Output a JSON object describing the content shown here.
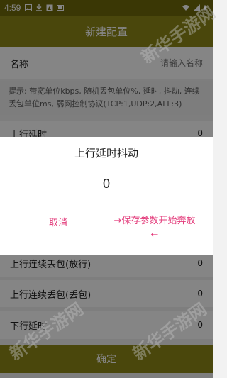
{
  "status_bar": {
    "time": "4:59",
    "left_icons": [
      "photo-icon",
      "download-icon",
      "image-icon",
      "app-badge-icon"
    ],
    "right_icons": [
      "wifi-icon",
      "signal-icon",
      "battery-icon"
    ]
  },
  "app_bar": {
    "title": "新建配置"
  },
  "form": {
    "name_label": "名称",
    "name_placeholder": "请输入名称",
    "hint": "提示: 带宽单位kbps, 随机丢包单位%, 延时, 抖动, 连续丢包单位ms, 弱网控制协议(TCP:1,UDP:2,ALL:3)",
    "rows": [
      {
        "label": "上行延时",
        "value": "0"
      },
      {
        "label": "上行连续丢包(放行)",
        "value": "0"
      },
      {
        "label": "上行连续丢包(丢包)",
        "value": "0"
      },
      {
        "label": "下行延时",
        "value": "0"
      }
    ],
    "confirm_label": "确定"
  },
  "dialog": {
    "title": "上行延时抖动",
    "value": "0",
    "cancel_label": "取消",
    "save_label": "→保存参数开始奔放←"
  },
  "watermark": "新华手游网",
  "colors": {
    "primary": "#8f8818",
    "status_bar": "#6f6a0a",
    "accent": "#e33a7a"
  }
}
